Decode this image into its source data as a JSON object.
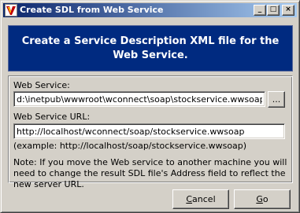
{
  "window": {
    "title": "Create SDL from Web Service"
  },
  "titlebar": {
    "minimize_label": "_",
    "maximize_label": "□",
    "close_label": "×"
  },
  "banner": {
    "text": "Create a Service Description XML file for the Web Service."
  },
  "form": {
    "web_service_label": "Web Service:",
    "web_service_value": "d:\\inetpub\\wwwroot\\wconnect\\soap\\stockservice.wwsoap",
    "browse_label": "...",
    "url_label": "Web Service URL:",
    "url_value": "http://localhost/wconnect/soap/stockservice.wwsoap",
    "example_text": "(example: http://localhost/soap/stockservice.wwsoap)",
    "note_text": "Note: If you move the Web service to another machine you will need to change the result SDL file's Address field to reflect the new server URL."
  },
  "buttons": {
    "cancel": {
      "prefix": "",
      "accel": "C",
      "rest": "ancel"
    },
    "go": {
      "prefix": "",
      "accel": "G",
      "rest": "o"
    }
  }
}
